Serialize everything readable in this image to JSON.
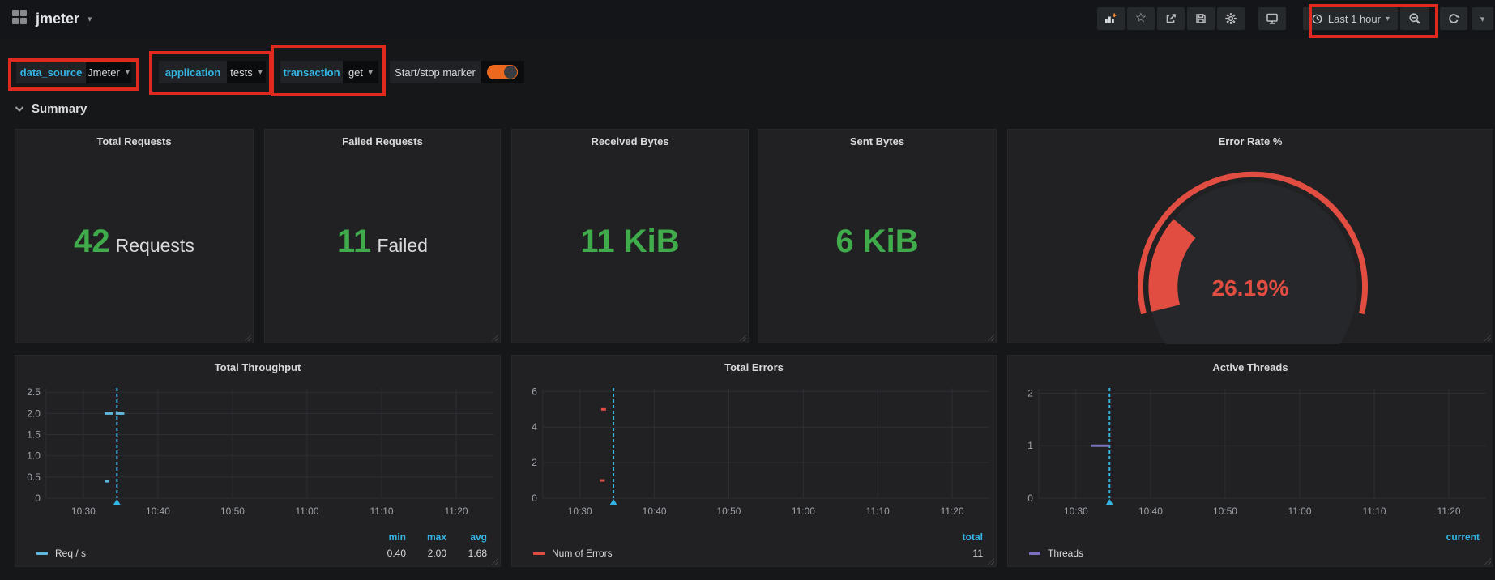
{
  "colors": {
    "accent_cyan": "#33b5e5",
    "stat_green": "#3fab4a",
    "alert_red": "#e24d42",
    "toggle_orange": "#eb681e",
    "annotation_red": "#e02a1f",
    "panel_bg": "#212124",
    "page_bg": "#161719"
  },
  "icons": {
    "caret_down": "▾",
    "star": "☆"
  },
  "nav": {
    "dashboard_title": "jmeter",
    "time_range": "Last 1 hour",
    "toolbar_icons": [
      "add-panel",
      "star",
      "share",
      "save",
      "settings",
      "cycle-view",
      "clock",
      "zoom-out",
      "refresh",
      "refresh-interval-caret"
    ]
  },
  "variables": {
    "data_source": {
      "label": "data_source",
      "value": "Jmeter"
    },
    "application": {
      "label": "application",
      "value": "tests"
    },
    "transaction": {
      "label": "transaction",
      "value": "get"
    },
    "marker": {
      "label": "Start/stop marker",
      "state": "on"
    }
  },
  "section": {
    "title": "Summary",
    "collapsed": false
  },
  "stat_panels": [
    {
      "title": "Total Requests",
      "value": "42",
      "suffix": "Requests"
    },
    {
      "title": "Failed Requests",
      "value": "11",
      "suffix": "Failed"
    },
    {
      "title": "Received Bytes",
      "value": "11 KiB",
      "suffix": ""
    },
    {
      "title": "Sent Bytes",
      "value": "6 KiB",
      "suffix": ""
    }
  ],
  "gauge_panel": {
    "title": "Error Rate %",
    "value": 26.19,
    "display": "26.19%",
    "min": 0,
    "max": 100,
    "color": "#e24d42"
  },
  "chart_data": [
    {
      "type": "scatter",
      "title": "Total Throughput",
      "x_domain": [
        "10:25",
        "11:25"
      ],
      "x_ticks": [
        "10:30",
        "10:40",
        "10:50",
        "11:00",
        "11:10",
        "11:20"
      ],
      "y_ticks": [
        0,
        0.5,
        1,
        1.5,
        2,
        2.5
      ],
      "y_tick_labels": [
        "0",
        "0.5",
        "1.0",
        "1.5",
        "2.0",
        "2.5"
      ],
      "y_max": 2.6,
      "grid": true,
      "legend_position": "bottom",
      "annotation_time": "10:34:30",
      "series": [
        {
          "name": "Req / s",
          "color": "#62b7dc",
          "draw": "dots",
          "points": [
            {
              "time": "10:33:10",
              "value": 2.0
            },
            {
              "time": "10:33:40",
              "value": 2.0
            },
            {
              "time": "10:34:40",
              "value": 2.0
            },
            {
              "time": "10:35:10",
              "value": 2.0
            },
            {
              "time": "10:33:10",
              "value": 0.4
            }
          ]
        }
      ],
      "legend_stats": [
        {
          "label": "min",
          "value": "0.40"
        },
        {
          "label": "max",
          "value": "2.00"
        },
        {
          "label": "avg",
          "value": "1.68"
        }
      ]
    },
    {
      "type": "scatter",
      "title": "Total Errors",
      "x_domain": [
        "10:25",
        "11:25"
      ],
      "x_ticks": [
        "10:30",
        "10:40",
        "10:50",
        "11:00",
        "11:10",
        "11:20"
      ],
      "y_ticks": [
        0,
        2,
        4,
        6
      ],
      "y_tick_labels": [
        "0",
        "2",
        "4",
        "6"
      ],
      "y_max": 6.2,
      "grid": true,
      "legend_position": "bottom",
      "annotation_time": "10:34:30",
      "series": [
        {
          "name": "Num of Errors",
          "color": "#e24d42",
          "draw": "dots",
          "points": [
            {
              "time": "10:33:10",
              "value": 5
            },
            {
              "time": "10:33:00",
              "value": 1
            }
          ]
        }
      ],
      "legend_stats": [
        {
          "label": "total",
          "value": "11"
        }
      ]
    },
    {
      "type": "scatter",
      "title": "Active Threads",
      "x_domain": [
        "10:25",
        "11:25"
      ],
      "x_ticks": [
        "10:30",
        "10:40",
        "10:50",
        "11:00",
        "11:10",
        "11:20"
      ],
      "y_ticks": [
        0,
        1,
        2
      ],
      "y_tick_labels": [
        "0",
        "1",
        "2"
      ],
      "y_max": 2.1,
      "grid": true,
      "legend_position": "bottom",
      "annotation_time": "10:34:30",
      "series": [
        {
          "name": "Threads",
          "color": "#7b72bd",
          "draw": "line",
          "points": [
            {
              "time": "10:32:00",
              "value": 1
            },
            {
              "time": "10:34:30",
              "value": 1
            }
          ]
        }
      ],
      "legend_stats": [
        {
          "label": "current",
          "value": ""
        }
      ]
    }
  ],
  "annotations": [
    {
      "target": "data_source-variable"
    },
    {
      "target": "application-variable"
    },
    {
      "target": "transaction-variable"
    },
    {
      "target": "time-range-picker"
    }
  ]
}
